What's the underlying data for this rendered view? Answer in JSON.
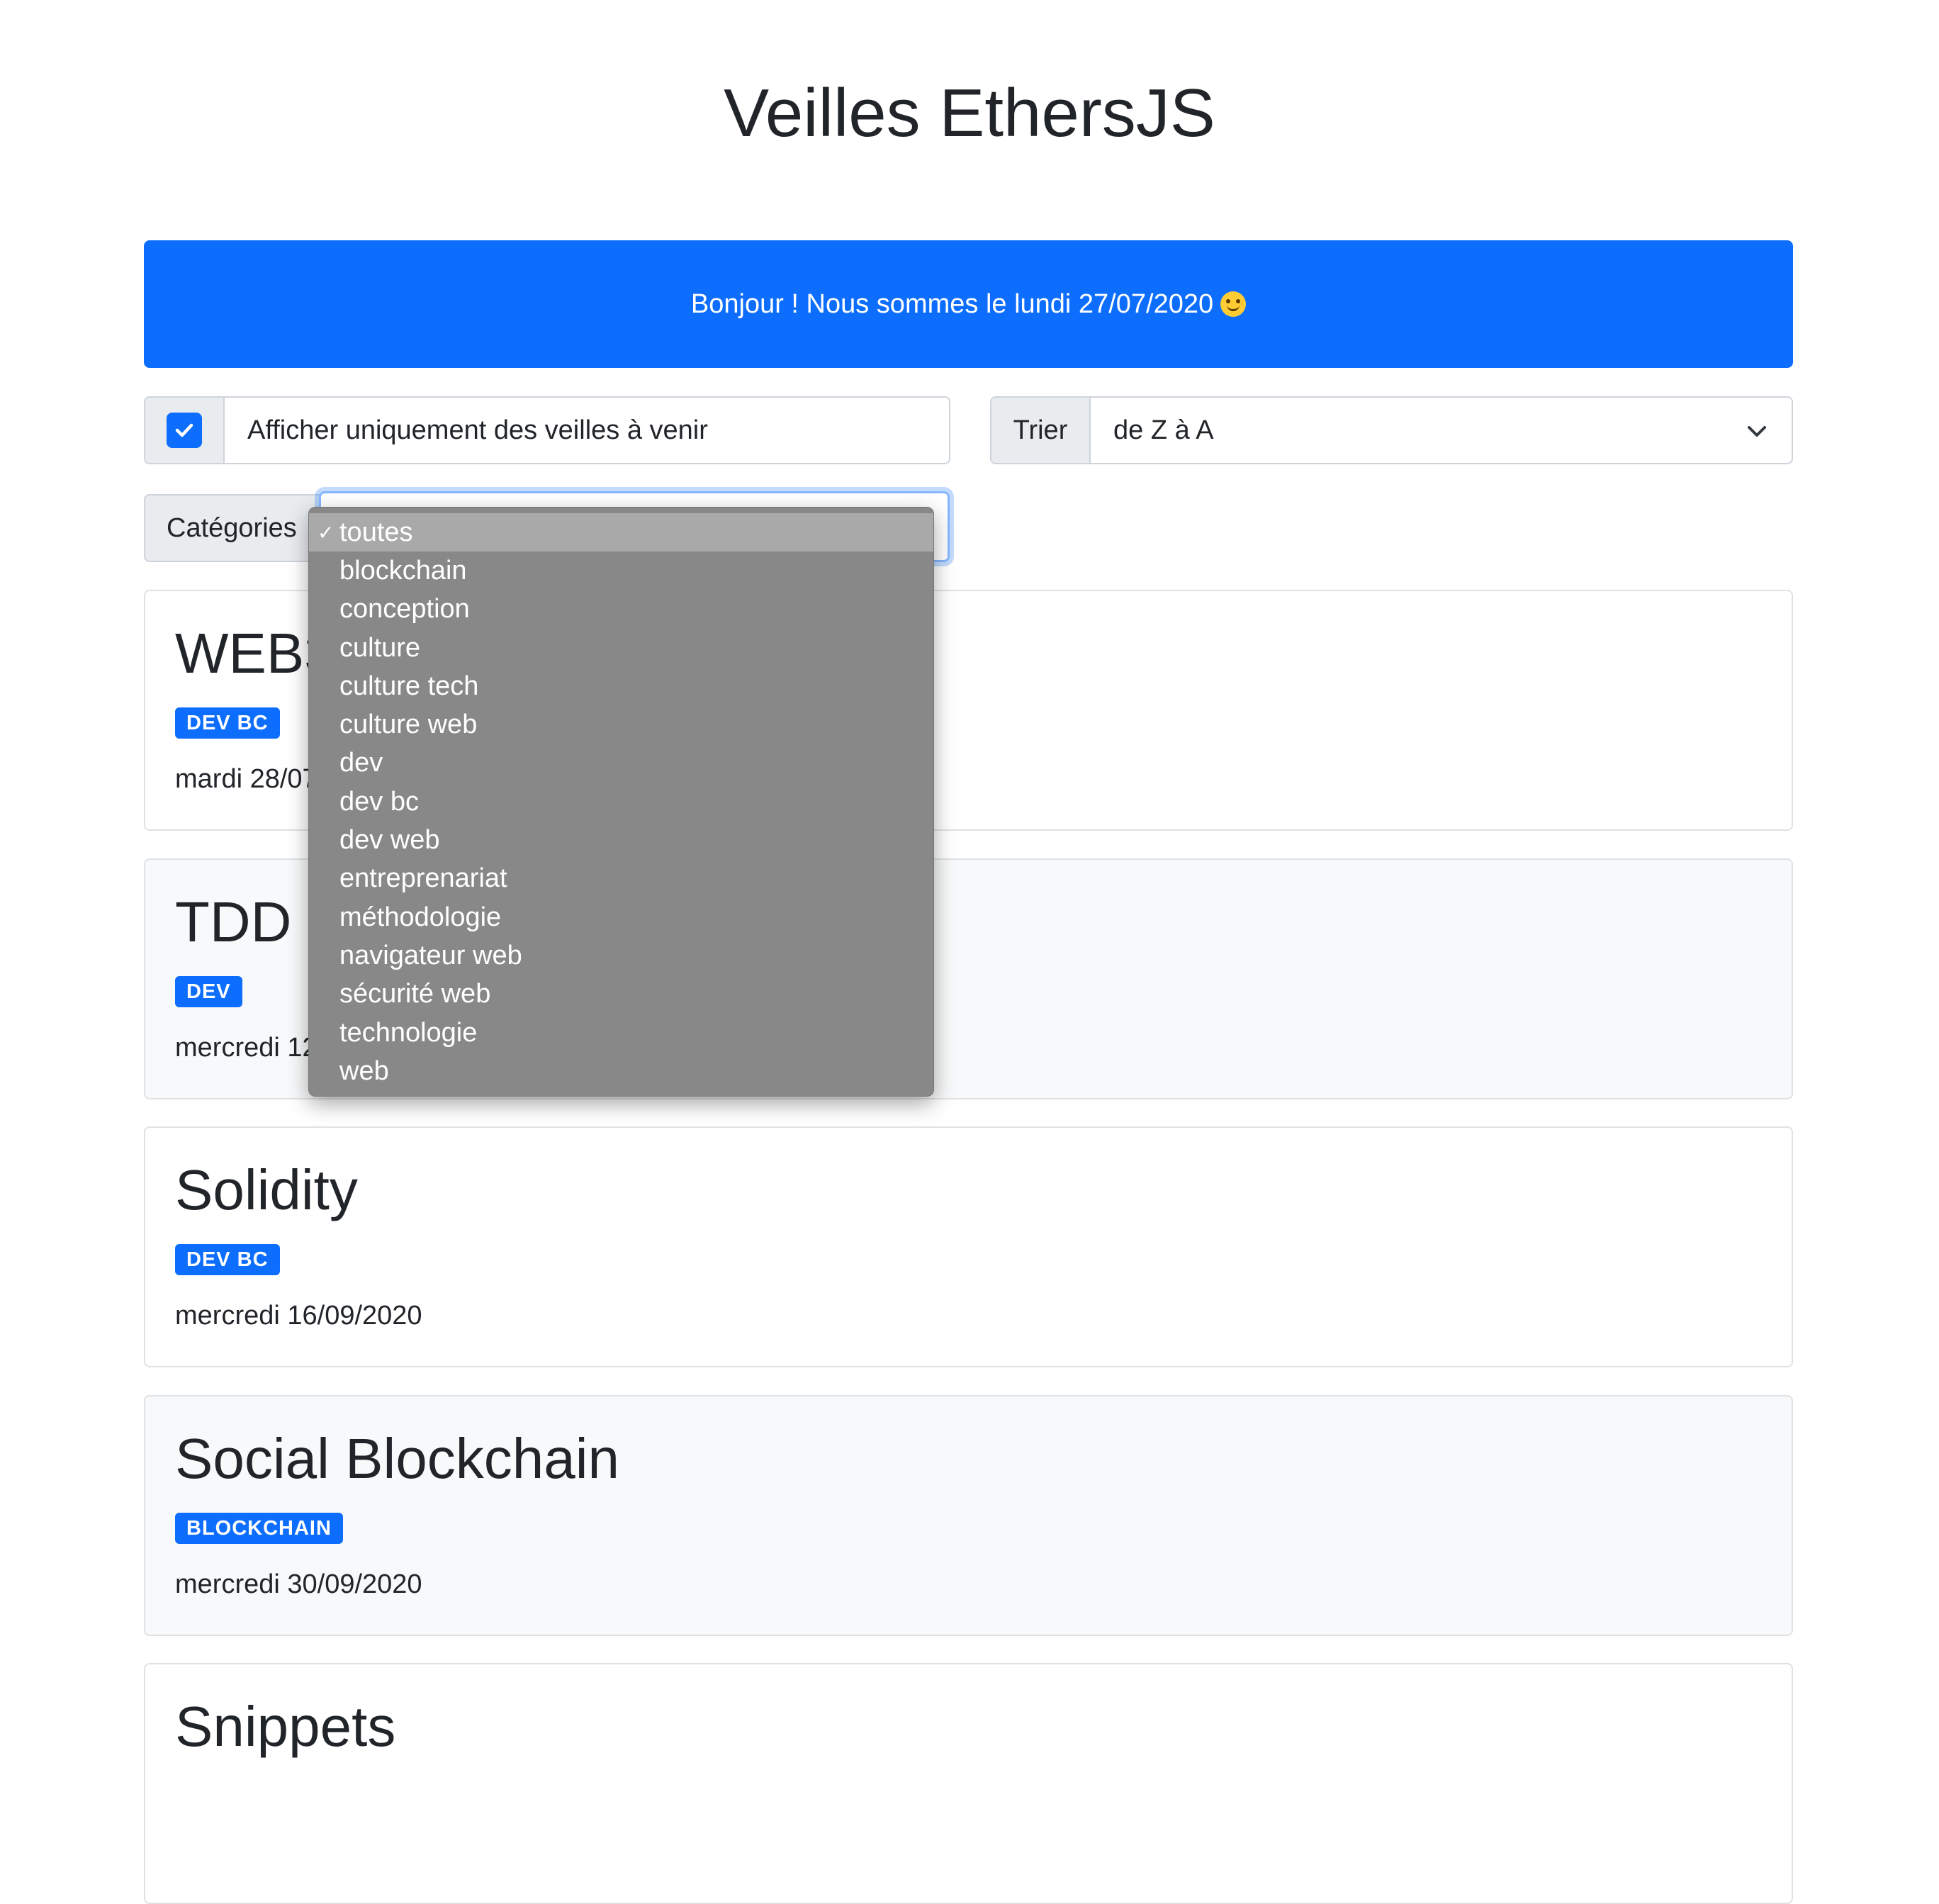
{
  "page_title": "Veilles EthersJS",
  "alert": {
    "text": "Bonjour ! Nous sommes le lundi 27/07/2020"
  },
  "filter": {
    "checked": true,
    "label": "Afficher uniquement des veilles à venir"
  },
  "sort": {
    "label": "Trier",
    "value": "de Z à A"
  },
  "categories": {
    "label": "Catégories",
    "selected_check": "✓",
    "options": [
      "toutes",
      "blockchain",
      "conception",
      "culture",
      "culture tech",
      "culture web",
      "dev",
      "dev bc",
      "dev web",
      "entreprenariat",
      "méthodologie",
      "navigateur web",
      "sécurité web",
      "technologie",
      "web"
    ]
  },
  "cards": [
    {
      "title": "WEB3",
      "badge": "DEV BC",
      "date": "mardi 28/07/2020"
    },
    {
      "title": "TDD",
      "badge": "DEV",
      "date": "mercredi 12/08/2020"
    },
    {
      "title": "Solidity",
      "badge": "DEV BC",
      "date": "mercredi 16/09/2020"
    },
    {
      "title": "Social Blockchain",
      "badge": "BLOCKCHAIN",
      "date": "mercredi 30/09/2020"
    },
    {
      "title": "Snippets",
      "badge": "",
      "date": ""
    }
  ],
  "colors": {
    "primary": "#0d6efd",
    "dropdown_bg": "#888888",
    "dropdown_selected": "#a9a9a9"
  }
}
